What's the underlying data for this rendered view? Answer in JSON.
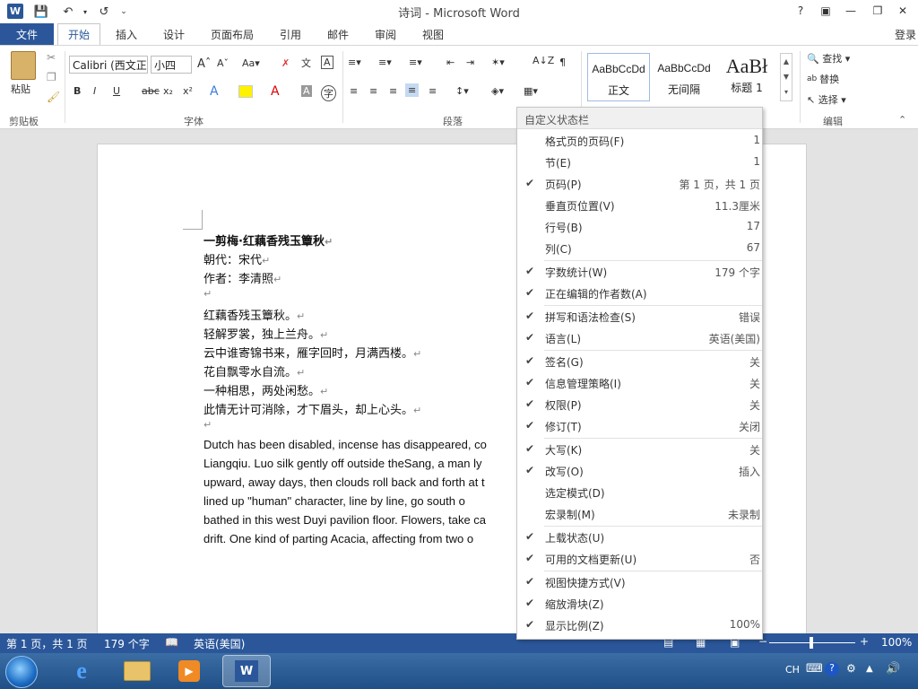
{
  "window": {
    "title": "诗词 - Microsoft Word",
    "login": "登录",
    "help": "?"
  },
  "tabs": {
    "file": "文件",
    "items": [
      "开始",
      "插入",
      "设计",
      "页面布局",
      "引用",
      "邮件",
      "审阅",
      "视图"
    ]
  },
  "ribbon": {
    "paste": "粘贴",
    "clipboard": "剪贴板",
    "font": "字体",
    "paragraph": "段落",
    "edit": "编辑",
    "font_name": "Calibri (西文正",
    "font_size": "小四",
    "styles": [
      {
        "preview": "AaBbCcDd",
        "name": "正文"
      },
      {
        "preview": "AaBbCcDd",
        "name": "无间隔"
      },
      {
        "preview": "AaBł",
        "name": "标题 1"
      }
    ],
    "find": "查找",
    "replace": "替换",
    "select": "选择"
  },
  "doc": {
    "title": "一剪梅·红藕香残玉簟秋",
    "dynasty": "朝代：宋代",
    "author": "作者：李清照",
    "poem": [
      "红藕香残玉簟秋。",
      "轻解罗裳，独上兰舟。",
      "云中谁寄锦书来，雁字回时，月满西楼。",
      "花自飘零水自流。",
      "一种相思，两处闲愁。",
      "此情无计可消除，才下眉头，却上心头。"
    ],
    "english": [
      "Dutch has been disabled, incense has disappeared, co",
      "Liangqiu. Luo silk gently off outside theSang, a man ly",
      "upward, away days, then clouds roll back and forth at t",
      "lined up \"human\" character, line by line, go south o",
      "bathed in this west Duyi pavilion floor. Flowers, take ca",
      "drift. One kind of parting Acacia, affecting from two o"
    ]
  },
  "menu": {
    "header": "自定义状态栏",
    "items": [
      {
        "label": "格式页的页码(F)",
        "value": "1",
        "checked": false
      },
      {
        "label": "节(E)",
        "value": "1",
        "checked": false
      },
      {
        "label": "页码(P)",
        "value": "第 1 页，共 1 页",
        "checked": true
      },
      {
        "label": "垂直页位置(V)",
        "value": "11.3厘米",
        "checked": false
      },
      {
        "label": "行号(B)",
        "value": "17",
        "checked": false
      },
      {
        "label": "列(C)",
        "value": "67",
        "checked": false,
        "sep": true
      },
      {
        "label": "字数统计(W)",
        "value": "179 个字",
        "checked": true
      },
      {
        "label": "正在编辑的作者数(A)",
        "value": "",
        "checked": true,
        "sep": true
      },
      {
        "label": "拼写和语法检查(S)",
        "value": "错误",
        "checked": true
      },
      {
        "label": "语言(L)",
        "value": "英语(美国)",
        "checked": true,
        "sep": true
      },
      {
        "label": "签名(G)",
        "value": "关",
        "checked": true
      },
      {
        "label": "信息管理策略(I)",
        "value": "关",
        "checked": true
      },
      {
        "label": "权限(P)",
        "value": "关",
        "checked": true
      },
      {
        "label": "修订(T)",
        "value": "关闭",
        "checked": true,
        "sep": true
      },
      {
        "label": "大写(K)",
        "value": "关",
        "checked": true
      },
      {
        "label": "改写(O)",
        "value": "插入",
        "checked": true
      },
      {
        "label": "选定模式(D)",
        "value": "",
        "checked": false
      },
      {
        "label": "宏录制(M)",
        "value": "未录制",
        "checked": false,
        "sep": true
      },
      {
        "label": "上载状态(U)",
        "value": "",
        "checked": true
      },
      {
        "label": "可用的文档更新(U)",
        "value": "否",
        "checked": true,
        "sep": true
      },
      {
        "label": "视图快捷方式(V)",
        "value": "",
        "checked": true
      },
      {
        "label": "缩放滑块(Z)",
        "value": "",
        "checked": true
      },
      {
        "label": "显示比例(Z)",
        "value": "100%",
        "checked": true
      }
    ]
  },
  "status": {
    "page": "第 1 页，共 1 页",
    "words": "179 个字",
    "language": "英语(美国)",
    "zoom": "100%"
  },
  "tray": {
    "lang": "CH"
  }
}
